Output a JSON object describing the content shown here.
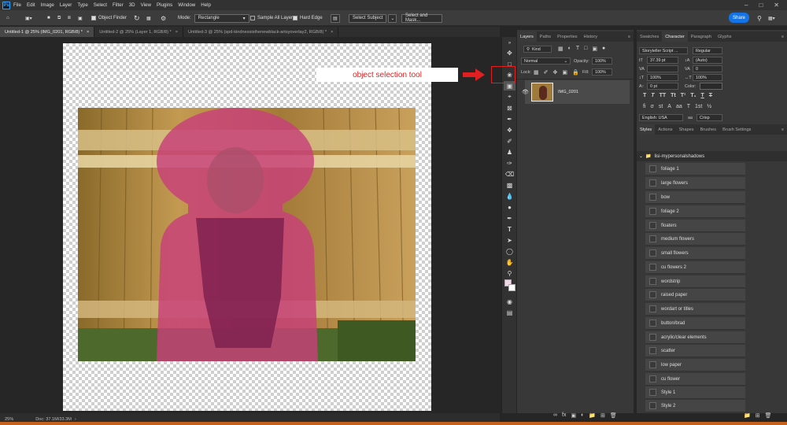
{
  "menu": {
    "items": [
      "File",
      "Edit",
      "Image",
      "Layer",
      "Type",
      "Select",
      "Filter",
      "3D",
      "View",
      "Plugins",
      "Window",
      "Help"
    ]
  },
  "options": {
    "object_finder": "Object Finder",
    "mode_label": "Mode:",
    "mode_value": "Rectangle",
    "sample_all": "Sample All Layers",
    "hard_edge": "Hard Edge",
    "select_subject": "Select Subject",
    "select_mask": "Select and Mask...",
    "share": "Share"
  },
  "tabs": [
    "Untitled-1 @ 25% (IMG_0201, RGB/8) *",
    "Untitled-2 @ 25% (Layer 1, RGB/8) *",
    "Untitled-3 @ 25% (spd-kindnessisthenewblack-artsyoverlay2, RGB/8) *"
  ],
  "status": {
    "zoom": "25%",
    "doc": "Doc: 37.1M/33.3M"
  },
  "annotation": {
    "label": "object selection tool"
  },
  "layers_panel": {
    "tabs": [
      "Layers",
      "Paths",
      "Properties",
      "History"
    ],
    "kind": "Kind",
    "blend": "Normal",
    "opacity_label": "Opacity:",
    "opacity": "100%",
    "lock_label": "Lock:",
    "fill_label": "Fill:",
    "fill": "100%",
    "layer_name": "IMG_0201"
  },
  "char_panel": {
    "tabs": [
      "Swatches",
      "Character",
      "Paragraph",
      "Glyphs"
    ],
    "font": "Storyteller Script ...",
    "style": "Regular",
    "size": "37.39 pt",
    "leading": "(Auto)",
    "tracking": "0",
    "vscale": "100%",
    "hscale": "100%",
    "baseline": "0 pt",
    "color_label": "Color:",
    "lang": "English: USA",
    "aa": "Crisp"
  },
  "styles_panel": {
    "tabs": [
      "Styles",
      "Actions",
      "Shapes",
      "Brushes",
      "Brush Settings"
    ],
    "group": "lisi-mypersonalshadows",
    "items": [
      "foliage 1",
      "large flowers",
      "bow",
      "foliage 2",
      "floaters",
      "medium flowers",
      "small flowers",
      "cu flowers 2",
      "wordstrip",
      "raised paper",
      "wordart or titles",
      "button/brad",
      "acrylic/clear elements",
      "scatter",
      "low paper",
      "cu flower",
      "Style 1",
      "Style 2"
    ]
  },
  "colors": {
    "accent": "#1473e6",
    "annotation": "#e02020",
    "overlay": "#c8407a"
  }
}
